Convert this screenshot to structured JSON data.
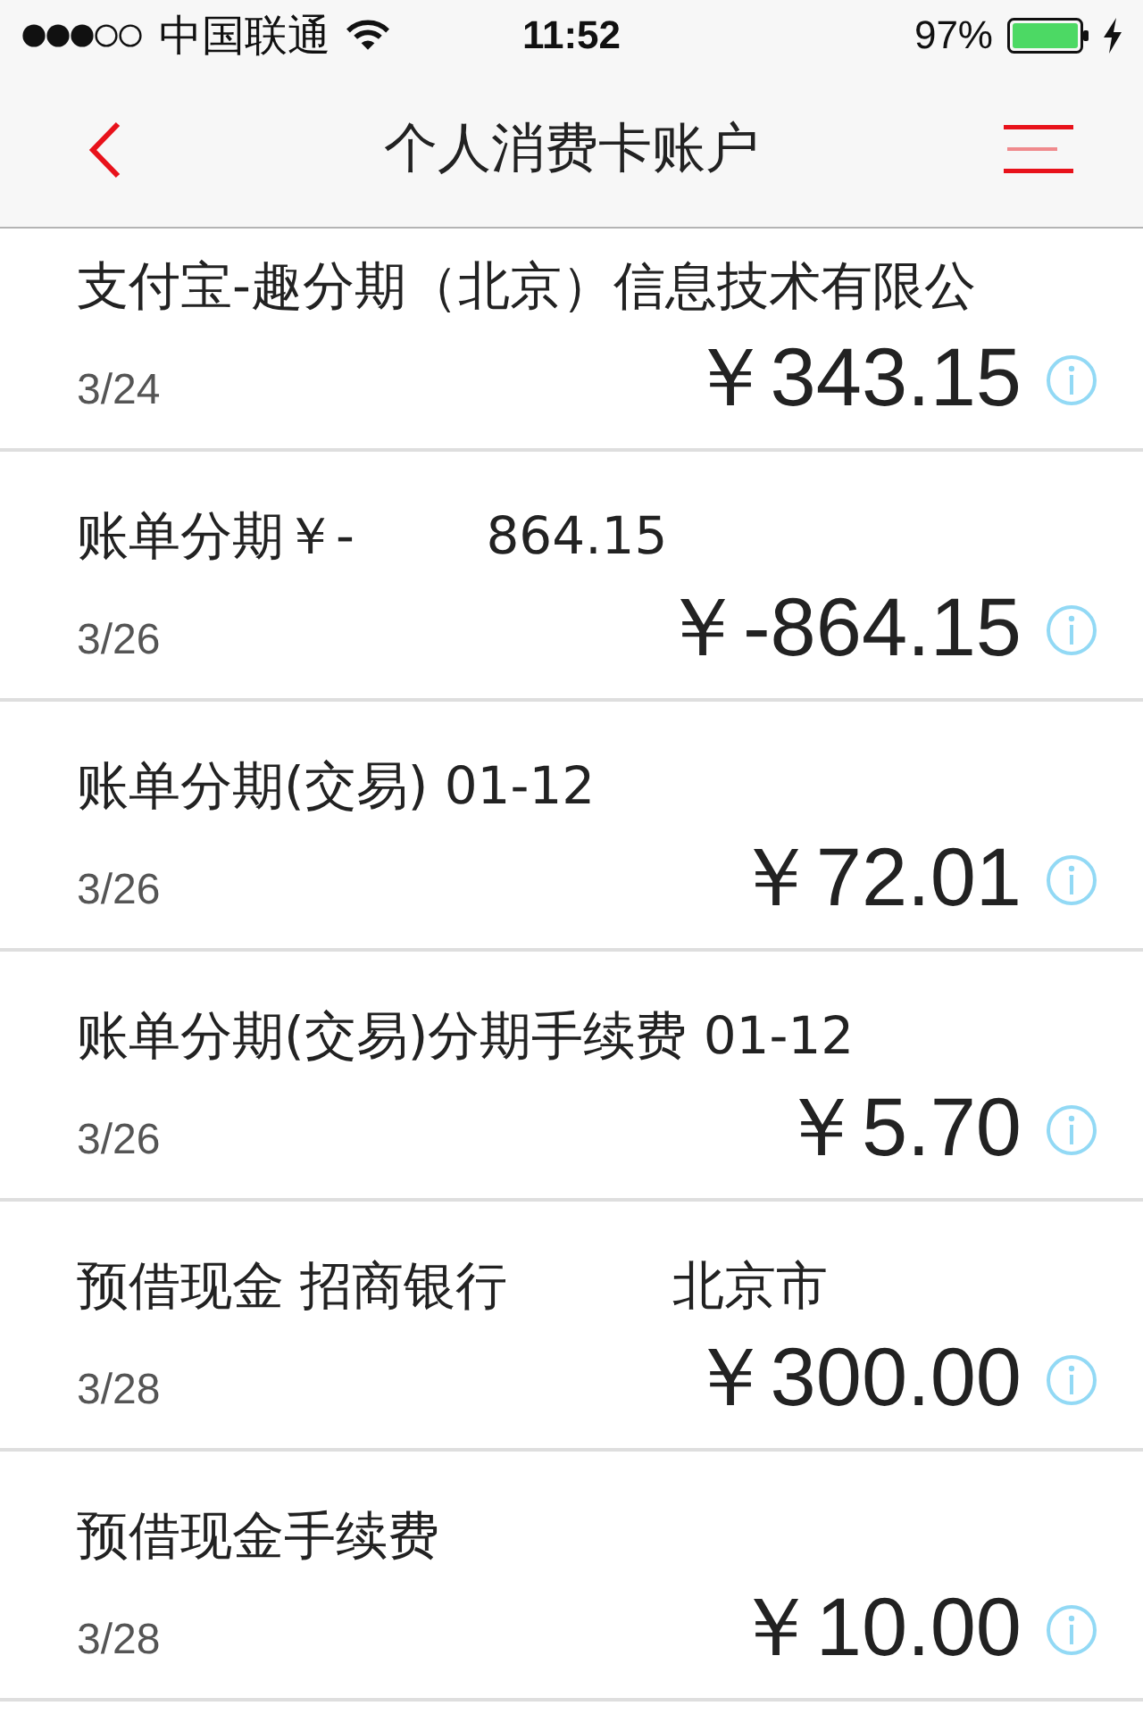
{
  "status_bar": {
    "carrier": "中国联通",
    "time": "11:52",
    "battery": "97%"
  },
  "nav_bar": {
    "title": "个人消费卡账户"
  },
  "transactions": [
    {
      "title": "支付宝-趣分期（北京）信息技术有限公",
      "date": "3/24",
      "amount": "￥343.15"
    },
    {
      "title": "账单分期￥-        864.15",
      "date": "3/26",
      "amount": "￥-864.15"
    },
    {
      "title": "账单分期(交易) 01-12",
      "date": "3/26",
      "amount": "￥72.01"
    },
    {
      "title": "账单分期(交易)分期手续费 01-12",
      "date": "3/26",
      "amount": "￥5.70"
    },
    {
      "title": "预借现金 招商银行          北京市",
      "date": "3/28",
      "amount": "￥300.00"
    },
    {
      "title": "预借现金手续费",
      "date": "3/28",
      "amount": "￥10.00"
    }
  ]
}
